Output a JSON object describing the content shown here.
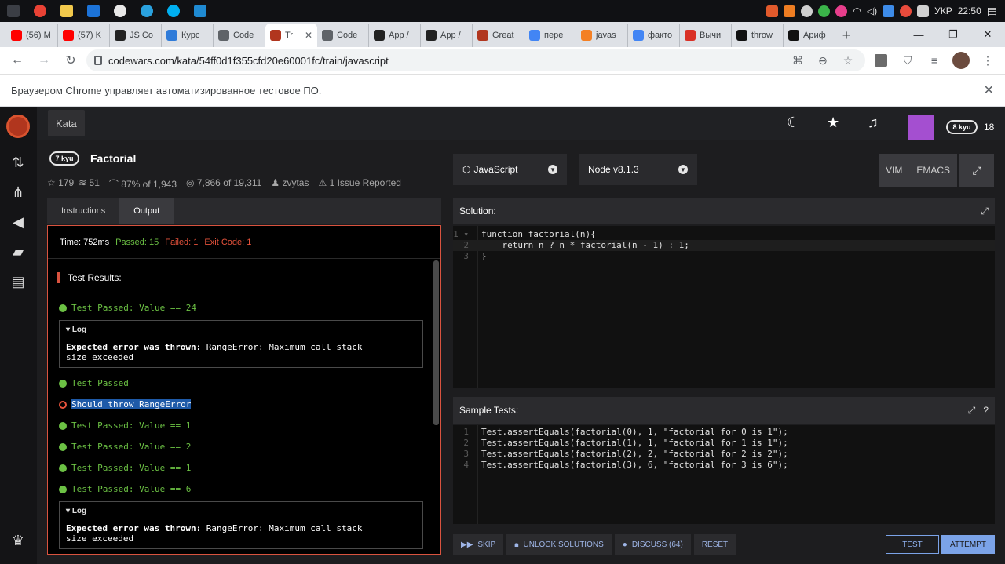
{
  "taskbar": {
    "apps": [
      {
        "name": "windows-start-icon",
        "color": "#2d2f34"
      },
      {
        "name": "chrome-icon",
        "color": "#e94235"
      },
      {
        "name": "file-explorer-icon",
        "color": "#f2c94c"
      },
      {
        "name": "photoshop-icon",
        "color": "#1c73d8"
      },
      {
        "name": "obs-icon",
        "color": "#e8e8e8"
      },
      {
        "name": "telegram-icon",
        "color": "#2aa1de"
      },
      {
        "name": "skype-icon",
        "color": "#00aff0"
      },
      {
        "name": "vscode-icon",
        "color": "#1f8ad2"
      }
    ],
    "tray": {
      "language": "УКР",
      "time": "22:50"
    }
  },
  "browser": {
    "tabs": [
      {
        "title": "(56) M",
        "favicon": "youtube-icon",
        "color": "#ff0000"
      },
      {
        "title": "(57) K",
        "favicon": "youtube-icon",
        "color": "#ff0000"
      },
      {
        "title": "JS Co",
        "favicon": "rs-icon",
        "color": "#222222"
      },
      {
        "title": "Курс",
        "favicon": "z-icon",
        "color": "#2f7bd9"
      },
      {
        "title": "Code",
        "favicon": "globe-icon",
        "color": "#5f6368"
      },
      {
        "title": "Tr",
        "favicon": "codewars-icon",
        "color": "#b1361e",
        "active": true
      },
      {
        "title": "Code",
        "favicon": "globe-icon",
        "color": "#5f6368"
      },
      {
        "title": "App /",
        "favicon": "rs-icon",
        "color": "#222222"
      },
      {
        "title": "App /",
        "favicon": "rs-icon",
        "color": "#222222"
      },
      {
        "title": "Great",
        "favicon": "codewars-icon",
        "color": "#b1361e"
      },
      {
        "title": "пере",
        "favicon": "google-icon",
        "color": "#4285f4"
      },
      {
        "title": "javas",
        "favicon": "stackoverflow-icon",
        "color": "#f48024"
      },
      {
        "title": "факто",
        "favicon": "google-icon",
        "color": "#4285f4"
      },
      {
        "title": "Вычи",
        "favicon": "person-icon",
        "color": "#d93025"
      },
      {
        "title": "throw",
        "favicon": "mdn-icon",
        "color": "#111111"
      },
      {
        "title": "Ариф",
        "favicon": "mdn-icon",
        "color": "#111111"
      }
    ],
    "url": "codewars.com/kata/54ff0d1f355cfd20e60001fc/train/javascript",
    "automation_notice": "Браузером Chrome управляет автоматизированное тестовое ПО."
  },
  "app": {
    "nav_kata": "Kata",
    "honor": "18",
    "user_rank": "8 kyu",
    "kata": {
      "rank": "7 kyu",
      "title": "Factorial",
      "stars": "179",
      "collections": "51",
      "satisfaction": "87% of 1,943",
      "completed": "7,866 of 19,311",
      "author": "zvytas",
      "issues": "1 Issue Reported"
    },
    "left_tabs": {
      "instructions": "Instructions",
      "output": "Output"
    },
    "output": {
      "time": "Time: 752ms",
      "passed": "Passed: 15",
      "failed": "Failed: 1",
      "exit": "Exit Code: 1",
      "results_title": "Test Results:",
      "lines": {
        "l1": "Test Passed: Value == 24",
        "log_label": "Log",
        "log_bold": "Expected error was thrown:",
        "log_rest": " RangeError: Maximum call stack",
        "log_rest2": "size exceeded",
        "l2": "Test Passed",
        "l3": "Should throw RangeError",
        "l4": "Test Passed: Value == 1",
        "l5": "Test Passed: Value == 2",
        "l6": "Test Passed: Value == 1",
        "l7": "Test Passed: Value == 6"
      }
    },
    "language": "JavaScript",
    "runtime": "Node v8.1.3",
    "modes": {
      "vim": "VIM",
      "emacs": "EMACS"
    },
    "solution": {
      "title": "Solution:",
      "lines": [
        "function factorial(n){",
        "    return n ? n * factorial(n - 1) : 1;",
        "}"
      ]
    },
    "sample_tests": {
      "title": "Sample Tests:",
      "lines": [
        "Test.assertEquals(factorial(0), 1, \"factorial for 0 is 1\");",
        "Test.assertEquals(factorial(1), 1, \"factorial for 1 is 1\");",
        "Test.assertEquals(factorial(2), 2, \"factorial for 2 is 2\");",
        "Test.assertEquals(factorial(3), 6, \"factorial for 3 is 6\");"
      ]
    },
    "buttons": {
      "skip": "SKIP",
      "unlock": "UNLOCK SOLUTIONS",
      "discuss": "DISCUSS (64)",
      "reset": "RESET",
      "test": "TEST",
      "attempt": "ATTEMPT"
    }
  }
}
